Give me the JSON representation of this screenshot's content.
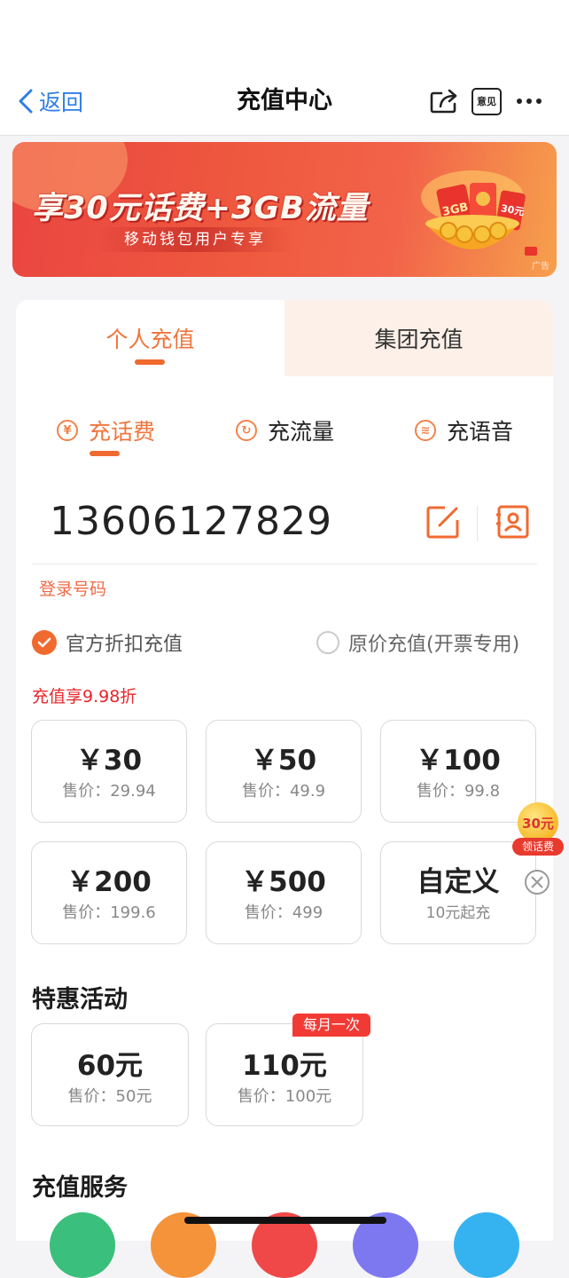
{
  "nav": {
    "back_label": "返回",
    "title": "充值中心",
    "feedback_label": "意见"
  },
  "banner": {
    "title": "享30元话费+3GB流量",
    "subtitle": "移动钱包用户专享",
    "ad_label": "广告",
    "graphic_texts": [
      "3GB",
      "30元"
    ]
  },
  "tabs": [
    {
      "label": "个人充值",
      "active": true
    },
    {
      "label": "集团充值",
      "active": false
    }
  ],
  "subtabs": [
    {
      "label": "充话费",
      "icon": "yen-circle-icon",
      "active": true
    },
    {
      "label": "充流量",
      "icon": "refresh-circle-icon",
      "active": false
    },
    {
      "label": "充语音",
      "icon": "voice-wave-icon",
      "active": false
    }
  ],
  "phone": {
    "number": "13606127829",
    "label": "登录号码"
  },
  "recharge_type": {
    "official": {
      "label": "官方折扣充值",
      "checked": true
    },
    "original": {
      "label": "原价充值(开票专用)",
      "checked": false
    }
  },
  "discount_note": "充值享9.98折",
  "options": [
    {
      "amount": "￥30",
      "price": "售价：29.94"
    },
    {
      "amount": "￥50",
      "price": "售价：49.9"
    },
    {
      "amount": "￥100",
      "price": "售价：99.8"
    },
    {
      "amount": "￥200",
      "price": "售价：199.6"
    },
    {
      "amount": "￥500",
      "price": "售价：499"
    },
    {
      "amount": "自定义",
      "price": "10元起充"
    }
  ],
  "float_promo": {
    "coin_text": "30元",
    "tag": "领话费"
  },
  "promotions": {
    "title": "特惠活动",
    "items": [
      {
        "amount": "60元",
        "price": "售价：50元",
        "tag": ""
      },
      {
        "amount": "110元",
        "price": "售价：100元",
        "tag": "每月一次"
      }
    ]
  },
  "services": {
    "title": "充值服务"
  },
  "colors": {
    "accent": "#f06a30",
    "link_blue": "#2f7ee6",
    "discount_red": "#e6262b",
    "tab_group_bg": "#fdf0e8"
  }
}
